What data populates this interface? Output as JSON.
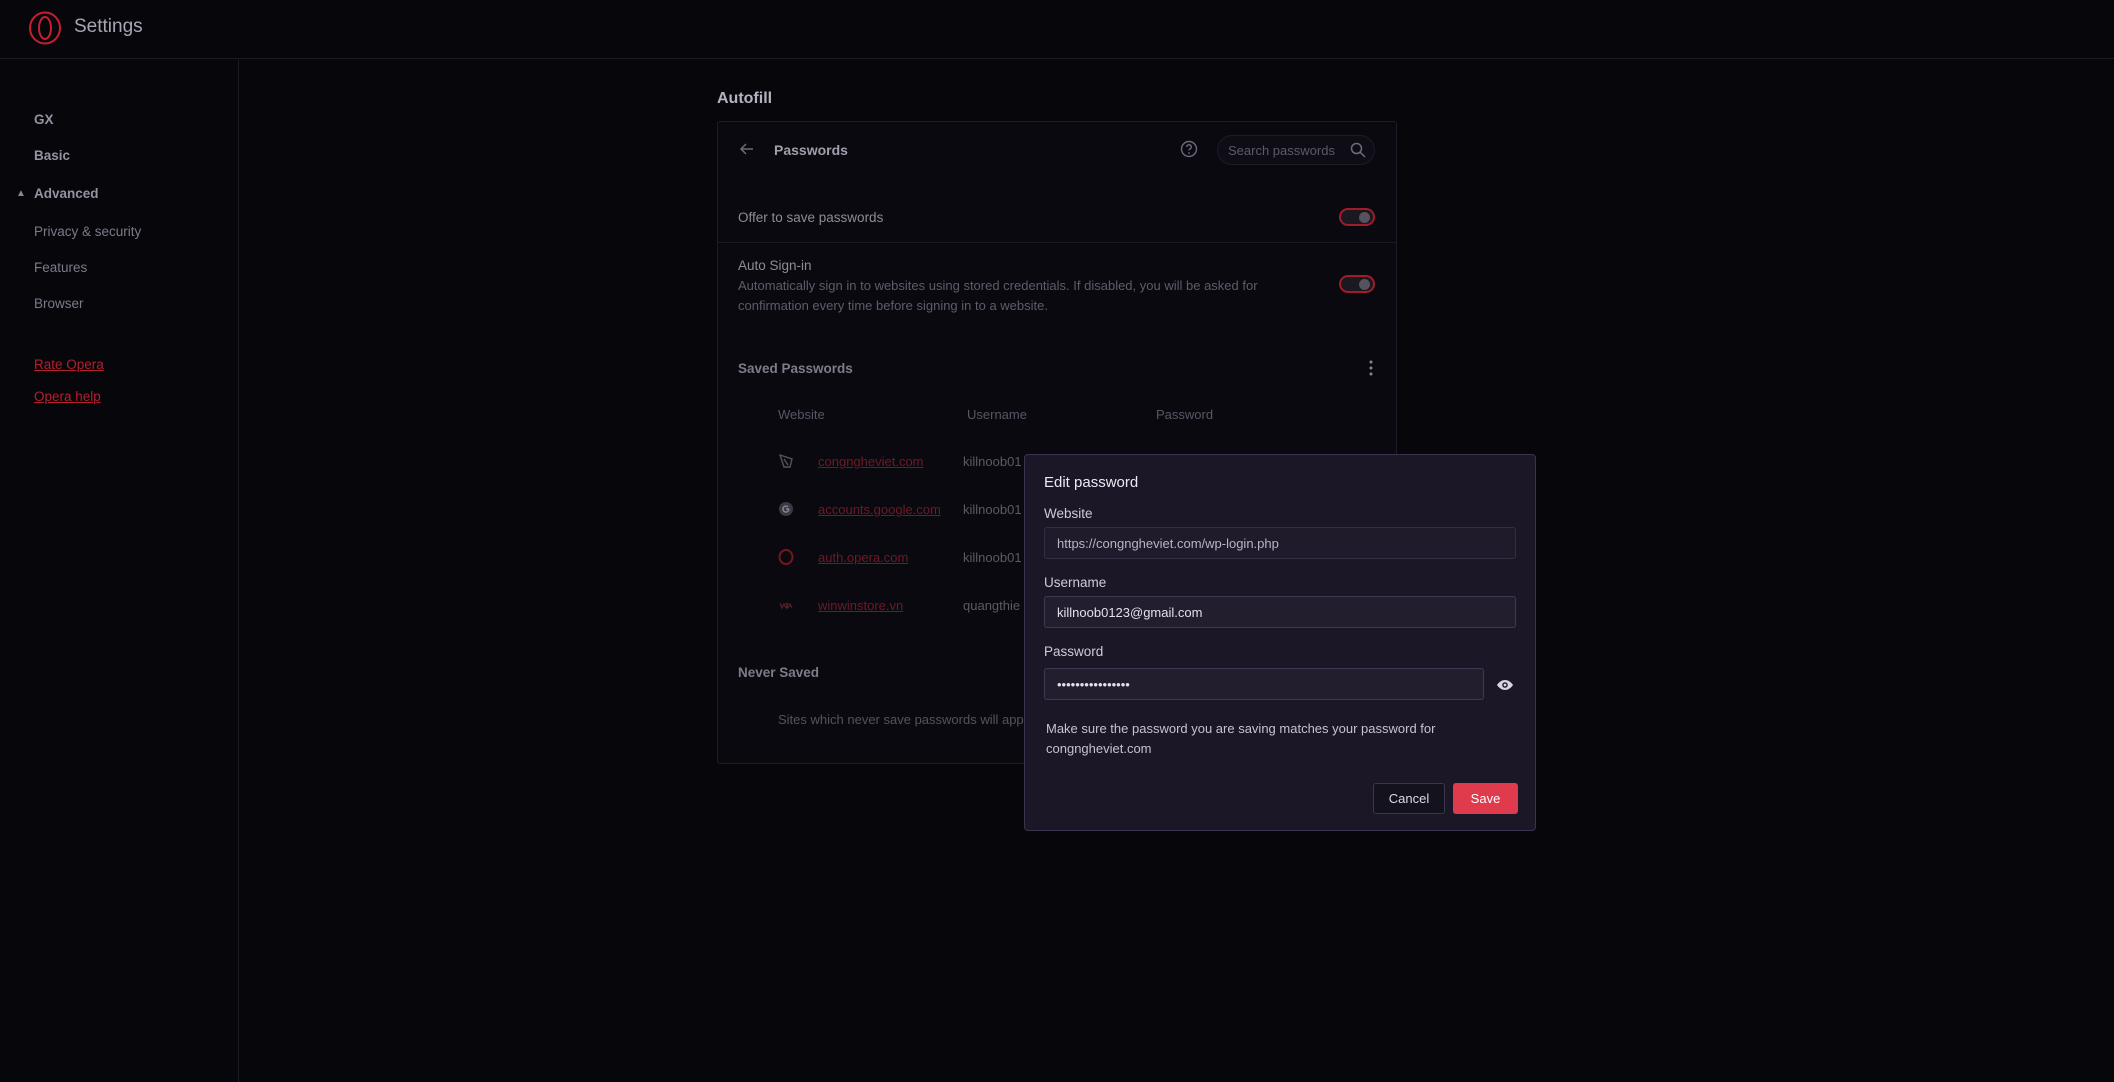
{
  "app": {
    "title": "Settings"
  },
  "sidebar": {
    "items": [
      {
        "label": "GX"
      },
      {
        "label": "Basic"
      },
      {
        "label": "Advanced"
      },
      {
        "label": "Privacy & security"
      },
      {
        "label": "Features"
      },
      {
        "label": "Browser"
      }
    ],
    "links": [
      {
        "label": "Rate Opera"
      },
      {
        "label": "Opera help"
      }
    ]
  },
  "section": {
    "title": "Autofill"
  },
  "passwords": {
    "title": "Passwords",
    "search_placeholder": "Search passwords",
    "offer_to_save": {
      "label": "Offer to save passwords",
      "enabled": true
    },
    "auto_signin": {
      "label": "Auto Sign-in",
      "description": "Automatically sign in to websites using stored credentials. If disabled, you will be asked for confirmation every time before signing in to a website.",
      "enabled": true
    },
    "saved_heading": "Saved Passwords",
    "columns": {
      "website": "Website",
      "username": "Username",
      "password": "Password"
    },
    "rows": [
      {
        "site": "congngheviet.com",
        "username": "killnoob01",
        "icon": "shield-icon"
      },
      {
        "site": "accounts.google.com",
        "username": "killnoob01",
        "icon": "google-icon"
      },
      {
        "site": "auth.opera.com",
        "username": "killnoob01",
        "icon": "opera-icon"
      },
      {
        "site": "winwinstore.vn",
        "username": "quangthie",
        "icon": "ww-icon"
      }
    ],
    "never_saved_heading": "Never Saved",
    "never_saved_desc": "Sites which never save passwords will appe"
  },
  "dialog": {
    "title": "Edit password",
    "website_label": "Website",
    "website_value": "https://congngheviet.com/wp-login.php",
    "username_label": "Username",
    "username_value": "killnoob0123@gmail.com",
    "password_label": "Password",
    "password_value": "••••••••••••••••",
    "note": "Make sure the password you are saving matches your password for congngheviet.com",
    "cancel_label": "Cancel",
    "save_label": "Save"
  },
  "colors": {
    "accent": "#e03a4d",
    "link": "#b3202e",
    "background": "#07060b"
  }
}
